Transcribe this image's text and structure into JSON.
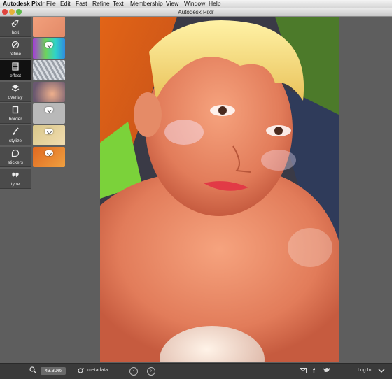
{
  "menubar": {
    "app": "Autodesk Pixlr",
    "items": [
      "File",
      "Edit",
      "Fast",
      "Refine",
      "Text",
      "Membership",
      "View",
      "Window",
      "Help"
    ]
  },
  "window": {
    "title": "Autodesk Pixlr"
  },
  "sidebar": {
    "tools": [
      {
        "label": "fast",
        "icon": "rocket-icon"
      },
      {
        "label": "refine",
        "icon": "refine-icon"
      },
      {
        "label": "effect",
        "icon": "film-icon",
        "active": true
      },
      {
        "label": "overlay",
        "icon": "layers-icon"
      },
      {
        "label": "border",
        "icon": "frame-icon"
      },
      {
        "label": "stylize",
        "icon": "brush-icon"
      },
      {
        "label": "stickers",
        "icon": "sticker-icon"
      },
      {
        "label": "type",
        "icon": "quote-icon"
      }
    ]
  },
  "statusbar": {
    "zoom": "43.30%",
    "metadata_label": "metadata",
    "login_label": "Log In"
  },
  "colors": {
    "toolbar_bg": "#4b4b4b",
    "active_tool_bg": "#111111",
    "canvas_bg": "#5e5e5e"
  }
}
